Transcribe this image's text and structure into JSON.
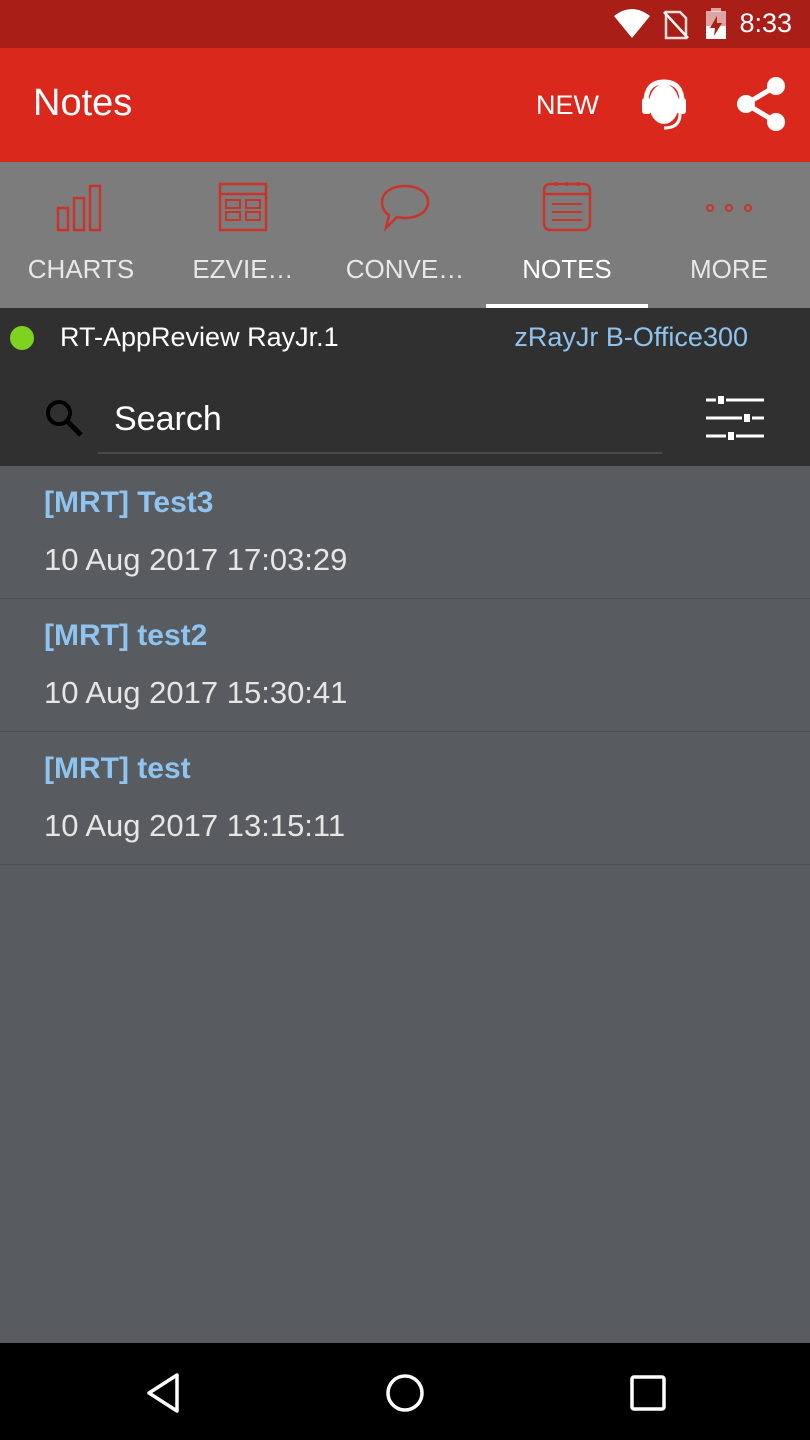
{
  "status_bar": {
    "time": "8:33",
    "icons": [
      "wifi-icon",
      "no-sim-icon",
      "battery-charging-icon"
    ]
  },
  "app_bar": {
    "title": "Notes",
    "new_label": "NEW",
    "icons": [
      "support-headset-icon",
      "share-icon"
    ]
  },
  "tabs": [
    {
      "label": "CHARTS",
      "icon": "bar-chart-icon"
    },
    {
      "label": "EZVIE…",
      "icon": "grid-table-icon"
    },
    {
      "label": "CONVE…",
      "icon": "speech-bubble-icon"
    },
    {
      "label": "NOTES",
      "icon": "notepad-icon",
      "active": true
    },
    {
      "label": "MORE",
      "icon": "more-dots-icon"
    }
  ],
  "account": {
    "name": "RT-AppReview RayJr.1",
    "server": "zRayJr B-Office300",
    "status_color": "#7ed321"
  },
  "search": {
    "placeholder": "Search"
  },
  "notes": [
    {
      "title": "[MRT] Test3",
      "date": "10 Aug 2017 17:03:29"
    },
    {
      "title": "[MRT] test2",
      "date": "10 Aug 2017 15:30:41"
    },
    {
      "title": "[MRT] test",
      "date": "10 Aug 2017 13:15:11"
    }
  ],
  "colors": {
    "status_bar": "#a91e17",
    "app_bar": "#db281c",
    "tab_bar": "#7c7c7c",
    "tab_icon": "#c9342a",
    "dark_bar": "#303030",
    "list_bg": "#585b60",
    "link": "#8ec4ef"
  },
  "nav_bar": {
    "icons": [
      "back-icon",
      "home-icon",
      "recents-icon"
    ]
  }
}
